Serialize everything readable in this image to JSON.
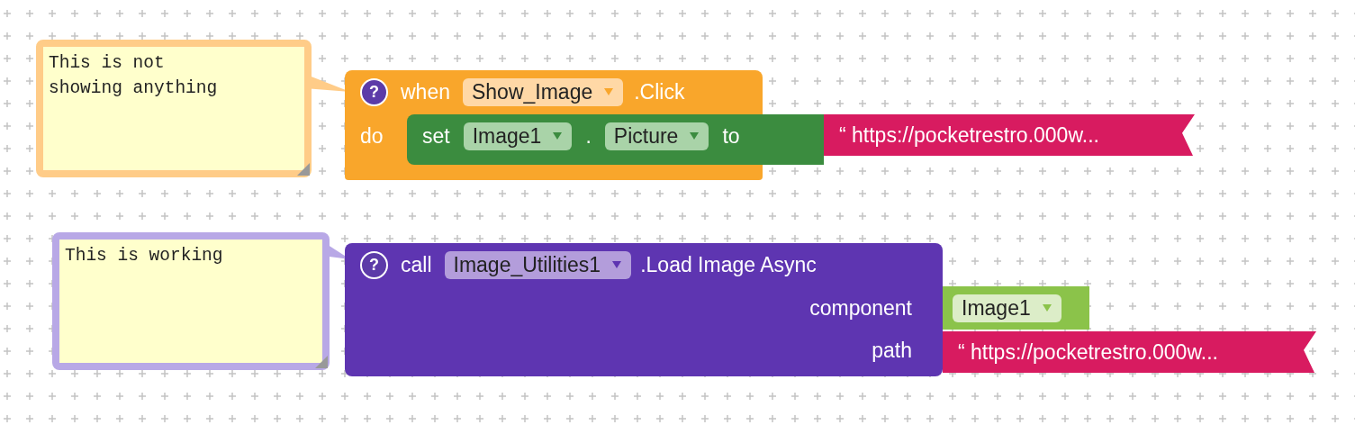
{
  "comments": [
    {
      "text": "This is not\nshowing anything",
      "color": "#ffcc88"
    },
    {
      "text": "This is working",
      "color": "#b8a8e6"
    }
  ],
  "event_block": {
    "help": "?",
    "keyword_when": "when",
    "component": "Show_Image",
    "event": ".Click",
    "keyword_do": "do",
    "statement": {
      "keyword_set": "set",
      "component": "Image1",
      "dot": ".",
      "property": "Picture",
      "keyword_to": "to",
      "value": "“ https://pocketrestro.000w..."
    }
  },
  "call_block": {
    "help": "?",
    "keyword": "call",
    "component": "Image_Utilities1",
    "method": ".Load Image Async",
    "args": [
      {
        "name": "component",
        "kind": "component",
        "value": "Image1"
      },
      {
        "name": "path",
        "kind": "text",
        "value": "“ https://pocketrestro.000w..."
      }
    ]
  }
}
